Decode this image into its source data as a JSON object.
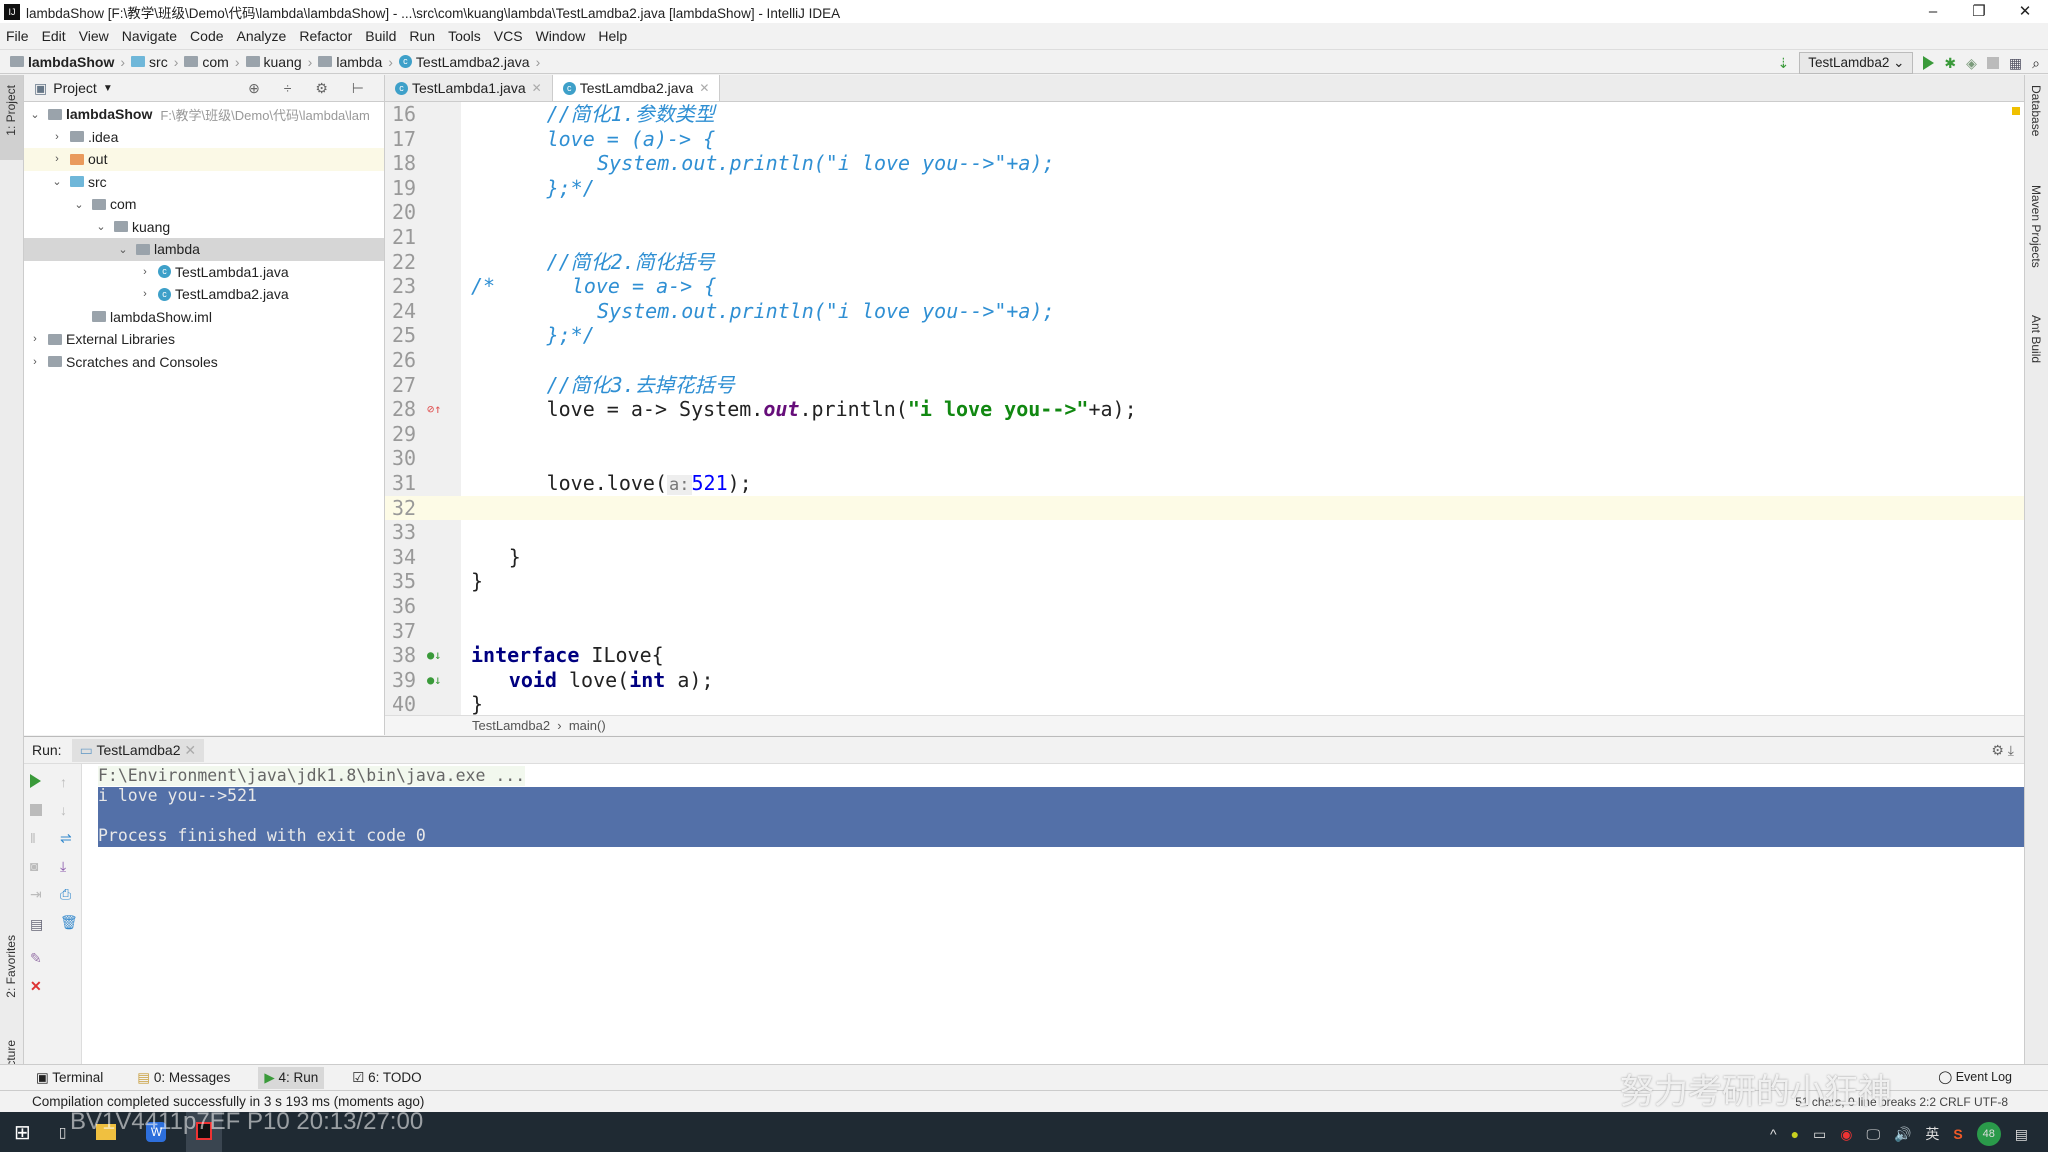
{
  "window": {
    "title": "lambdaShow [F:\\教学\\班级\\Demo\\代码\\lambda\\lambdaShow] - ...\\src\\com\\kuang\\lambda\\TestLamdba2.java [lambdaShow] - IntelliJ IDEA",
    "controls": [
      "–",
      "❐",
      "✕"
    ]
  },
  "menu": [
    "File",
    "Edit",
    "View",
    "Navigate",
    "Code",
    "Analyze",
    "Refactor",
    "Build",
    "Run",
    "Tools",
    "VCS",
    "Window",
    "Help"
  ],
  "breadcrumb": [
    "lambdaShow",
    "src",
    "com",
    "kuang",
    "lambda",
    "TestLamdba2.java"
  ],
  "toolbar": {
    "run_config": "TestLamdba2"
  },
  "left_strip": {
    "project": "1: Project",
    "favorites": "2: Favorites",
    "structure": "7: Structure"
  },
  "right_strip": [
    "Database",
    "Maven Projects",
    "Ant Build"
  ],
  "project": {
    "header": "Project",
    "root_path": "F:\\教学\\班级\\Demo\\代码\\lambda\\lam",
    "tree": [
      {
        "label": "lambdaShow",
        "arrow": "v",
        "icon": "module"
      },
      {
        "label": ".idea",
        "arrow": ">",
        "icon": "folder"
      },
      {
        "label": "out",
        "arrow": ">",
        "icon": "folder-orange"
      },
      {
        "label": "src",
        "arrow": "v",
        "icon": "folder-blue"
      },
      {
        "label": "com",
        "arrow": "v",
        "icon": "package"
      },
      {
        "label": "kuang",
        "arrow": "v",
        "icon": "package"
      },
      {
        "label": "lambda",
        "arrow": "v",
        "icon": "package"
      },
      {
        "label": "TestLambda1.java",
        "arrow": ">",
        "icon": "class"
      },
      {
        "label": "TestLamdba2.java",
        "arrow": ">",
        "icon": "class"
      },
      {
        "label": "lambdaShow.iml",
        "arrow": "",
        "icon": "file"
      },
      {
        "label": "External Libraries",
        "arrow": ">",
        "icon": "library"
      },
      {
        "label": "Scratches and Consoles",
        "arrow": ">",
        "icon": "scratch"
      }
    ]
  },
  "tabs": [
    {
      "label": "TestLambda1.java",
      "active": false
    },
    {
      "label": "TestLamdba2.java",
      "active": true
    }
  ],
  "code": {
    "line_numbers": [
      "16",
      "17",
      "18",
      "19",
      "20",
      "21",
      "22",
      "23",
      "24",
      "25",
      "26",
      "27",
      "28",
      "29",
      "30",
      "31",
      "32",
      "33",
      "34",
      "35",
      "36",
      "37",
      "38",
      "39",
      "40"
    ],
    "l16": "//简化1.参数类型",
    "l17": "love = (a)-> {",
    "l18": "System.out.println(\"i love you-->\"+a);",
    "l19": "};*/",
    "l22": "//简化2.简化括号",
    "l23a": "/*",
    "l23": "love = a-> {",
    "l24": "System.out.println(\"i love you-->\"+a);",
    "l25": "};*/",
    "l27": "//简化3.去掉花括号",
    "l28a": "love = a-> System.",
    "l28b": "out",
    "l28c": ".println(",
    "l28d": "\"i love you-->\"",
    "l28e": "+a);",
    "l31a": "love.love(",
    "l31hint": "a:",
    "l31num": "521",
    "l31b": ");",
    "l34": "}",
    "l35": "}",
    "l38kw": "interface",
    "l38": " ILove{",
    "l39kw1": "void",
    "l39a": " love(",
    "l39kw2": "int",
    "l39b": " a);",
    "l40": "}"
  },
  "editor_breadcrumb": [
    "TestLamdba2",
    "main()"
  ],
  "run": {
    "label": "Run:",
    "tab": "TestLamdba2",
    "console": [
      "F:\\Environment\\java\\jdk1.8\\bin\\java.exe ...",
      "i love you-->521",
      "",
      "Process finished with exit code 0"
    ]
  },
  "bottom_tabs": [
    {
      "label": "Terminal"
    },
    {
      "label": "0: Messages"
    },
    {
      "label": "4: Run",
      "active": true
    },
    {
      "label": "6: TODO"
    }
  ],
  "event_log": "Event Log",
  "status": {
    "message": "Compilation completed successfully in 3 s 193 ms (moments ago)",
    "right": "51 chars, 0 line breaks   2:2   CRLF   UTF-8"
  },
  "overlay": {
    "video_id": "BV1V4411p7EF P10 20:13/27:00",
    "channel": "努力考研的小狂神"
  },
  "taskbar": {
    "tray": [
      "^",
      "英",
      "48"
    ]
  },
  "colors": {
    "selection": "#5370a8",
    "comment": "#2f8fd3",
    "keyword": "#000080",
    "string": "#118811",
    "taskbar": "#1f2a33"
  }
}
